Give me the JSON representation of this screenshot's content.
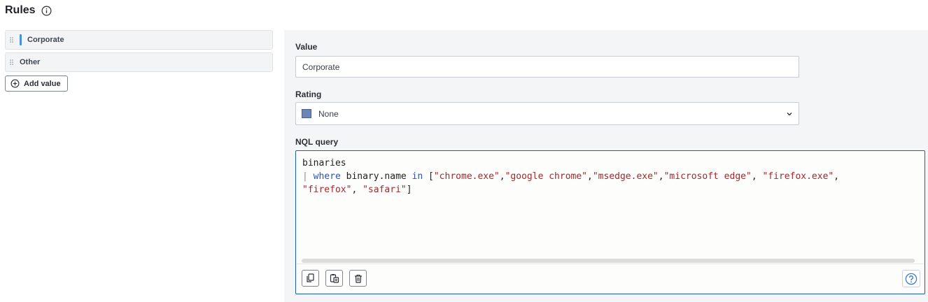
{
  "header": {
    "title": "Rules",
    "info_icon": "info-icon"
  },
  "rules": {
    "items": [
      {
        "label": "Corporate",
        "selected": true
      },
      {
        "label": "Other",
        "selected": false
      }
    ],
    "add_label": "Add value"
  },
  "form": {
    "value_label": "Value",
    "value_input": "Corporate",
    "rating_label": "Rating",
    "rating_value": "None",
    "rating_color": "#6b85b8",
    "query_label": "NQL query"
  },
  "query": {
    "line1": "binaries",
    "pipe": "|",
    "kw_where": "where",
    "field": "binary.name",
    "kw_in": "in",
    "open": "[",
    "s1": "\"chrome.exe\"",
    "s2": "\"google chrome\"",
    "s3": "\"msedge.exe\"",
    "s4": "\"microsoft edge\"",
    "s5": "\"firefox.exe\"",
    "s6": "\"firefox\"",
    "s7": "\"safari\"",
    "close": "]"
  },
  "toolbar": {
    "icons": [
      "copy-icon",
      "paste-icon",
      "trash-icon",
      "help-icon"
    ]
  },
  "colors": {
    "accent": "#4a90d9",
    "editor_border": "#1f5da1",
    "keyword": "#2b53b8",
    "string": "#a4282d"
  }
}
